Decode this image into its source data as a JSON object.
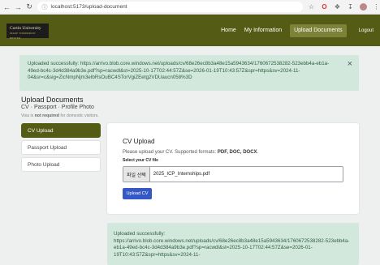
{
  "browser": {
    "back_icon": "back-arrow",
    "forward_icon": "forward-arrow",
    "reload_icon": "reload",
    "url": "localhost:5173/upload-document",
    "icons": [
      "star",
      "opera",
      "puzzle",
      "download",
      "avatar",
      "menu"
    ]
  },
  "header": {
    "logo_line1": "Curtin University",
    "logo_line2": "MAKE TOMORROW BETTER",
    "nav": [
      "Home",
      "My Information",
      "Upload Documents"
    ],
    "active_nav": "Upload Documents",
    "logout": "Logout",
    "color": "#545b14"
  },
  "alert_top": {
    "text": "Uploaded successfully: https://arrivo.blob.core.windows.net/uploads/cv/68e26ec8b3a48e15a5943634/1760672538282-523ebb4a-eb1a-49ed-bc4c-3d4d384a9b3e.pdf?sp=racwdl&st=2025-10-17T02:44:57Z&se=2026-01-19T10:43:57Z&spr=https&sv=2024-11-04&sr=c&sig=ZicNmpNjm3eIbRsOuBC4STorVgiZEetg2VDUaucn058%3D",
    "close": "×"
  },
  "upload": {
    "title": "Upload Documents",
    "subtitle": "CV · Passport · Profile Photo",
    "visa_pre": "Visa is ",
    "visa_bold": "not required",
    "visa_post": " for domestic visitors."
  },
  "sidebar": {
    "items": [
      "CV Upload",
      "Passport Upload",
      "Photo Upload"
    ],
    "active": "CV Upload"
  },
  "card": {
    "title": "CV Upload",
    "desc_pre": "Please upload your CV. Supported formats: ",
    "desc_formats": "PDF, DOC, DOCX",
    "desc_post": ".",
    "label": "Select your CV file",
    "file_button": "파일 선택",
    "file_name": "2025_ICP_Internships.pdf",
    "upload_button": "Upload CV"
  },
  "alert_bottom": {
    "text": "Uploaded successfully: https://arrivo.blob.core.windows.net/uploads/cv/68e26ec8b3a48e15a5943634/1760672538282-523ebb4a-eb1a-49ed-bc4c-3d4d384a9b3e.pdf?sp=racwdl&st=2025-10-17T02:44:57Z&se=2026-01-19T10:43:57Z&spr=https&sv=2024-11-"
  }
}
